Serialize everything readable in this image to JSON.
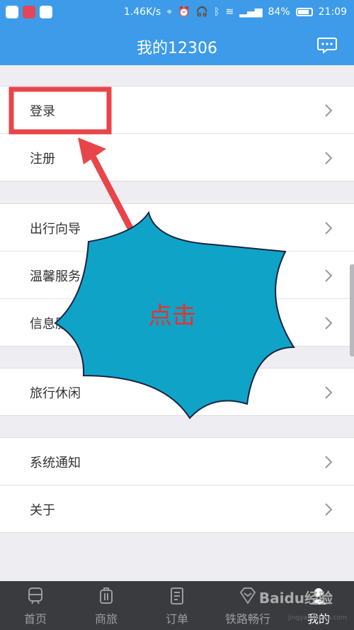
{
  "status_bar": {
    "speed": "1.46K/s",
    "battery": "84%",
    "battery_level": 0.84,
    "time": "21:09"
  },
  "header": {
    "title": "我的12306",
    "message_icon": "chat-bubble-icon"
  },
  "groups": [
    {
      "items": [
        {
          "label": "登录"
        },
        {
          "label": "注册"
        }
      ]
    },
    {
      "items": [
        {
          "label": "出行向导"
        },
        {
          "label": "温馨服务"
        },
        {
          "label": "信息服务"
        }
      ]
    },
    {
      "items": [
        {
          "label": "旅行休闲"
        }
      ]
    },
    {
      "items": [
        {
          "label": "系统通知"
        },
        {
          "label": "关于"
        }
      ]
    }
  ],
  "tabs": [
    {
      "label": "首页",
      "icon": "train-icon"
    },
    {
      "label": "商旅",
      "icon": "luggage-icon"
    },
    {
      "label": "订单",
      "icon": "order-list-icon"
    },
    {
      "label": "铁路畅行",
      "icon": "diamond-icon"
    },
    {
      "label": "我的",
      "icon": "user-icon"
    }
  ],
  "annotation": {
    "callout_text": "点击",
    "highlight_color": "#e8454a",
    "burst_color": "#10a3c8"
  },
  "watermark": {
    "logo": "Baidu经验",
    "site": "jingyan.baidu.com"
  },
  "colors": {
    "primary": "#3d9be9",
    "tabbar": "#3a3b3e"
  }
}
